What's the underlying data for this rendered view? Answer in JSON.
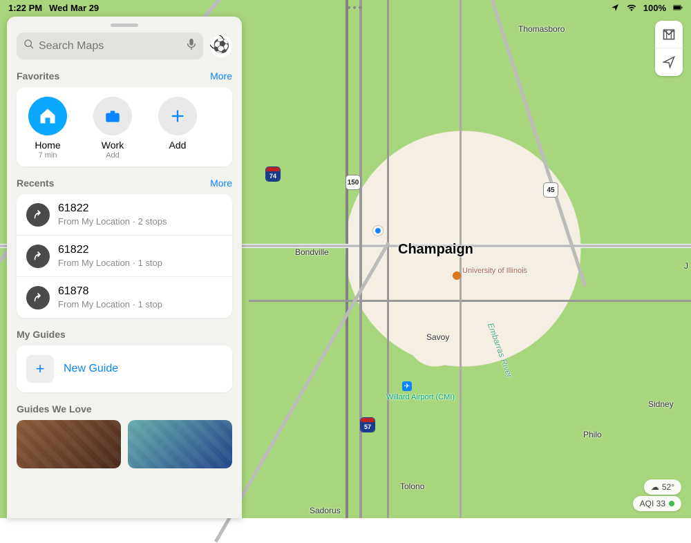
{
  "status_bar": {
    "time": "1:22 PM",
    "date": "Wed Mar 29",
    "battery_pct": "100%"
  },
  "search": {
    "placeholder": "Search Maps"
  },
  "favorites": {
    "heading": "Favorites",
    "more": "More",
    "items": [
      {
        "label": "Home",
        "sub": "7 min",
        "icon": "house",
        "style": "blue"
      },
      {
        "label": "Work",
        "sub": "Add",
        "icon": "briefcase",
        "style": "gray"
      },
      {
        "label": "Add",
        "sub": "",
        "icon": "plus",
        "style": "gray"
      }
    ]
  },
  "recents": {
    "heading": "Recents",
    "more": "More",
    "items": [
      {
        "title": "61822",
        "subtitle": "From My Location · 2 stops"
      },
      {
        "title": "61822",
        "subtitle": "From My Location · 1 stop"
      },
      {
        "title": "61878",
        "subtitle": "From My Location · 1 stop"
      }
    ]
  },
  "my_guides": {
    "heading": "My Guides",
    "new_guide_label": "New Guide"
  },
  "guides_we_love": {
    "heading": "Guides We Love"
  },
  "map": {
    "city": "Champaign",
    "labels": {
      "thomasboro": "Thomasboro",
      "bondville": "Bondville",
      "univ": "University of Illinois",
      "savoy": "Savoy",
      "airport": "Willard Airport (CMI)",
      "sidney": "Sidney",
      "philo": "Philo",
      "tolono": "Tolono",
      "sadorus": "Sadorus",
      "river": "Embarras River",
      "edge_j": "J"
    },
    "shields": {
      "i74": "74",
      "i57": "57",
      "us150": "150",
      "us45": "45"
    },
    "weather_temp": "52°",
    "aqi_label": "AQI 33"
  }
}
